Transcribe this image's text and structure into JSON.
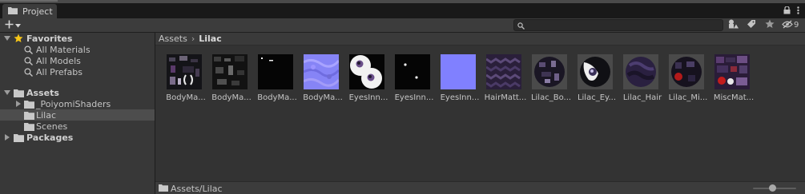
{
  "window": {
    "tab_label": "Project",
    "tab_icon": "folder-icon"
  },
  "toolbar": {
    "create_icon": "plus-icon",
    "search": {
      "placeholder": "",
      "value": ""
    },
    "hidden_packages_count": "9"
  },
  "tree": {
    "favorites": {
      "label": "Favorites",
      "items": [
        "All Materials",
        "All Models",
        "All Prefabs"
      ]
    },
    "assets": {
      "label": "Assets",
      "children": [
        "_PoiyomiShaders",
        "Lilac",
        "Scenes"
      ],
      "selected": "Lilac"
    },
    "packages": {
      "label": "Packages"
    }
  },
  "breadcrumb": {
    "root": "Assets",
    "current": "Lilac"
  },
  "assets_grid": [
    {
      "name": "BodyMa...",
      "thumb": "dark-texture"
    },
    {
      "name": "BodyMa...",
      "thumb": "dark-texture-2"
    },
    {
      "name": "BodyMa...",
      "thumb": "black-dots"
    },
    {
      "name": "BodyMa...",
      "thumb": "normal-map"
    },
    {
      "name": "EyesInn...",
      "thumb": "eye-white"
    },
    {
      "name": "EyesInn...",
      "thumb": "black-dots"
    },
    {
      "name": "EyesInn...",
      "thumb": "flat-normal"
    },
    {
      "name": "HairMatt...",
      "thumb": "purple-pattern"
    },
    {
      "name": "Lilac_Bo...",
      "thumb": "sphere-dark"
    },
    {
      "name": "Lilac_Ey...",
      "thumb": "sphere-eye"
    },
    {
      "name": "Lilac_Hair",
      "thumb": "sphere-purple"
    },
    {
      "name": "Lilac_Mi...",
      "thumb": "sphere-red"
    },
    {
      "name": "MiscMat...",
      "thumb": "misc-texture"
    }
  ],
  "status": {
    "path": "Assets/Lilac",
    "zoom_fraction": 0.45
  },
  "colors": {
    "panel": "#383838",
    "grid_bg": "#333333",
    "selection": "#4d4d4d",
    "star": "#f5c518",
    "normal_blue": "#8080ff"
  }
}
